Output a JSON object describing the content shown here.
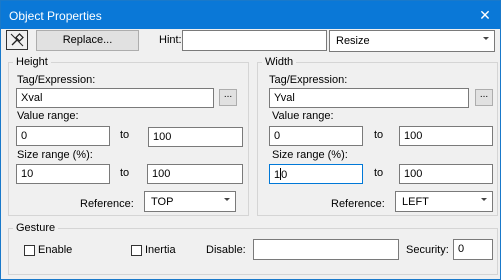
{
  "window": {
    "title": "Object Properties"
  },
  "toolbar": {
    "replace_label": "Replace...",
    "hint_label": "Hint:",
    "hint_value": "",
    "mode_value": "Resize"
  },
  "height_group": {
    "title": "Height",
    "tag_label": "Tag/Expression:",
    "tag_value": "Xval",
    "browse_label": "...",
    "value_range_label": "Value range:",
    "value_min": "0",
    "to_label_1": "to",
    "value_max": "100",
    "size_range_label": "Size range (%):",
    "size_min": "10",
    "to_label_2": "to",
    "size_max": "100",
    "reference_label": "Reference:",
    "reference_value": "TOP"
  },
  "width_group": {
    "title": "Width",
    "tag_label": "Tag/Expression:",
    "tag_value": "Yval",
    "browse_label": "...",
    "value_range_label": "Value range:",
    "value_min": "0",
    "to_label_1": "to",
    "value_max": "100",
    "size_range_label": "Size range (%):",
    "size_min_before_caret": "1",
    "size_min_after_caret": "0",
    "to_label_2": "to",
    "size_max": "100",
    "reference_label": "Reference:",
    "reference_value": "LEFT"
  },
  "gesture_group": {
    "title": "Gesture",
    "enable_label": "Enable",
    "inertia_label": "Inertia",
    "disable_label": "Disable:",
    "disable_value": "",
    "security_label": "Security:",
    "security_value": "0"
  },
  "icons": {
    "close": "close-icon",
    "pin": "pin-icon"
  }
}
